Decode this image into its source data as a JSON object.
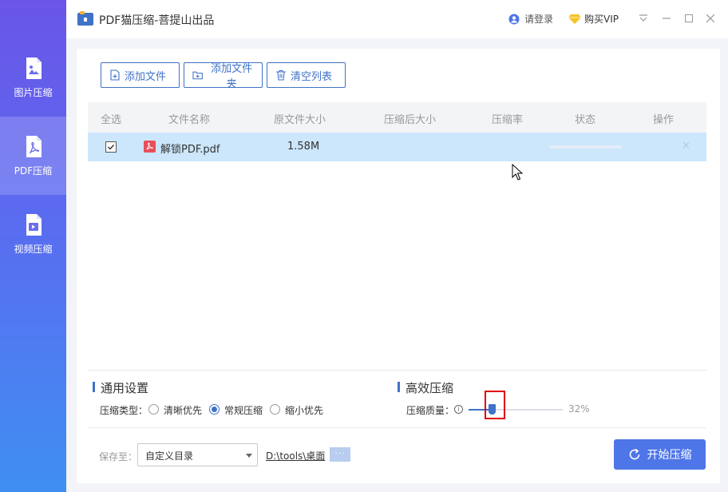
{
  "app": {
    "title": "PDF猫压缩-菩提山出品"
  },
  "header": {
    "login": "请登录",
    "vip": "购买VIP"
  },
  "sidebar": {
    "items": [
      {
        "label": "图片压缩",
        "icon": "image-file-icon",
        "active": false
      },
      {
        "label": "PDF压缩",
        "icon": "pdf-file-icon",
        "active": true
      },
      {
        "label": "视频压缩",
        "icon": "video-file-icon",
        "active": false
      }
    ]
  },
  "toolbar": {
    "add_file": "添加文件",
    "add_folder": "添加文件夹",
    "clear_list": "清空列表"
  },
  "table": {
    "columns": [
      "全选",
      "文件名称",
      "原文件大小",
      "压缩后大小",
      "压缩率",
      "状态",
      "操作"
    ],
    "rows": [
      {
        "checked": true,
        "name": "解锁PDF.pdf",
        "original_size": "1.58M",
        "compressed_size": "",
        "ratio": "",
        "remove": "×"
      }
    ]
  },
  "settings": {
    "general_title": "通用设置",
    "type_label": "压缩类型：",
    "options": [
      "清晰优先",
      "常规压缩",
      "缩小优先"
    ],
    "selected_option": "常规压缩",
    "efficient_title": "高效压缩",
    "quality_label": "压缩质量：",
    "quality_value": "32%"
  },
  "footer": {
    "save_label": "保存至：",
    "save_option": "自定义目录",
    "save_path": "D:\\tools\\桌面",
    "more": "···",
    "start_button": "开始压缩"
  },
  "colors": {
    "accent": "#3f72c8",
    "start_button": "#4f76e8",
    "selected_row": "#cce6fb"
  }
}
